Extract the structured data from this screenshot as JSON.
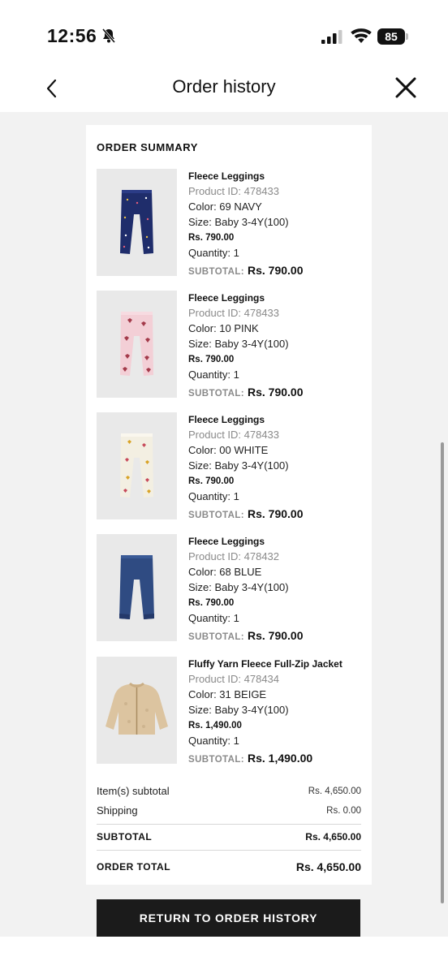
{
  "status_bar": {
    "time": "12:56",
    "battery": "85",
    "icons": [
      "bell-slash-icon",
      "signal-icon",
      "wifi-icon",
      "battery-icon"
    ]
  },
  "nav": {
    "title": "Order history",
    "back_icon": "chevron-left-icon",
    "close_icon": "close-icon"
  },
  "summary": {
    "title": "ORDER SUMMARY",
    "subtotal_label": "SUBTOTAL:",
    "items": [
      {
        "name": "Fleece Leggings",
        "product_id": "Product ID: 478433",
        "color": "Color: 69 NAVY",
        "size": "Size: Baby 3-4Y(100)",
        "price": "Rs. 790.00",
        "quantity": "Quantity: 1",
        "subtotal": "Rs. 790.00",
        "image": "navy-leggings"
      },
      {
        "name": "Fleece Leggings",
        "product_id": "Product ID: 478433",
        "color": "Color: 10 PINK",
        "size": "Size: Baby 3-4Y(100)",
        "price": "Rs. 790.00",
        "quantity": "Quantity: 1",
        "subtotal": "Rs. 790.00",
        "image": "pink-leggings"
      },
      {
        "name": "Fleece Leggings",
        "product_id": "Product ID: 478433",
        "color": "Color: 00 WHITE",
        "size": "Size: Baby 3-4Y(100)",
        "price": "Rs. 790.00",
        "quantity": "Quantity: 1",
        "subtotal": "Rs. 790.00",
        "image": "white-leggings"
      },
      {
        "name": "Fleece Leggings",
        "product_id": "Product ID: 478432",
        "color": "Color: 68 BLUE",
        "size": "Size: Baby 3-4Y(100)",
        "price": "Rs. 790.00",
        "quantity": "Quantity: 1",
        "subtotal": "Rs. 790.00",
        "image": "blue-leggings"
      },
      {
        "name": "Fluffy Yarn Fleece Full-Zip Jacket",
        "product_id": "Product ID: 478434",
        "color": "Color: 31 BEIGE",
        "size": "Size: Baby 3-4Y(100)",
        "price": "Rs. 1,490.00",
        "quantity": "Quantity: 1",
        "subtotal": "Rs. 1,490.00",
        "image": "beige-jacket"
      }
    ]
  },
  "totals": {
    "items_subtotal_label": "Item(s) subtotal",
    "items_subtotal": "Rs. 4,650.00",
    "shipping_label": "Shipping",
    "shipping": "Rs. 0.00",
    "subtotal_label": "SUBTOTAL",
    "subtotal": "Rs. 4,650.00",
    "order_total_label": "ORDER TOTAL",
    "order_total": "Rs. 4,650.00"
  },
  "actions": {
    "return_label": "RETURN TO ORDER HISTORY"
  },
  "colors": {
    "navy": "#1f2d6b",
    "pink": "#f3cfd6",
    "white": "#f3efe2",
    "blue": "#2f4b82",
    "beige": "#dcc4a0",
    "button": "#1b1b1b",
    "background": "#f2f2f2"
  }
}
